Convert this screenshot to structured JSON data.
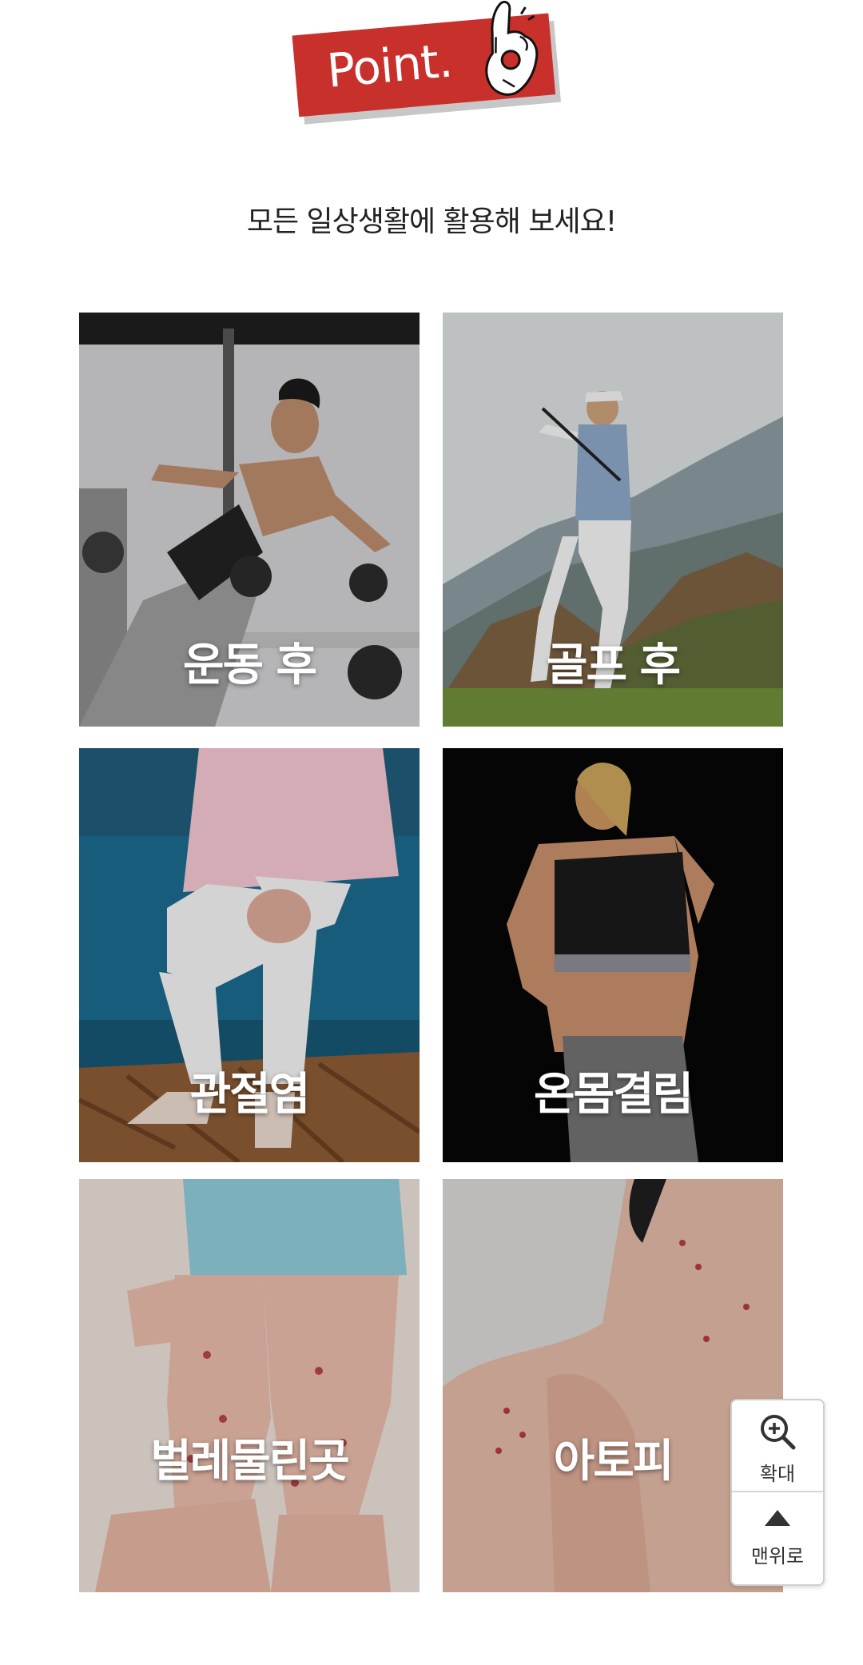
{
  "header": {
    "badge_text": "Point.",
    "badge_color": "#c8302c",
    "hand_icon": "ok-hand-icon",
    "subtitle": "모든 일상생활에 활용해 보세요!"
  },
  "uses": [
    {
      "label": "운동 후",
      "image": "woman lifting dumbbells in gym"
    },
    {
      "label": "골프 후",
      "image": "golfer swinging on course"
    },
    {
      "label": "관절염",
      "image": "older woman holding knee on sofa"
    },
    {
      "label": "온몸결림",
      "image": "woman holding sore back"
    },
    {
      "label": "벌레물린곳",
      "image": "child legs with bug bites"
    },
    {
      "label": "아토피",
      "image": "skin rash on shoulder"
    }
  ],
  "floating": {
    "zoom_label": "확대",
    "zoom_icon": "zoom-in-icon",
    "top_label": "맨위로",
    "top_icon": "arrow-up-icon"
  }
}
